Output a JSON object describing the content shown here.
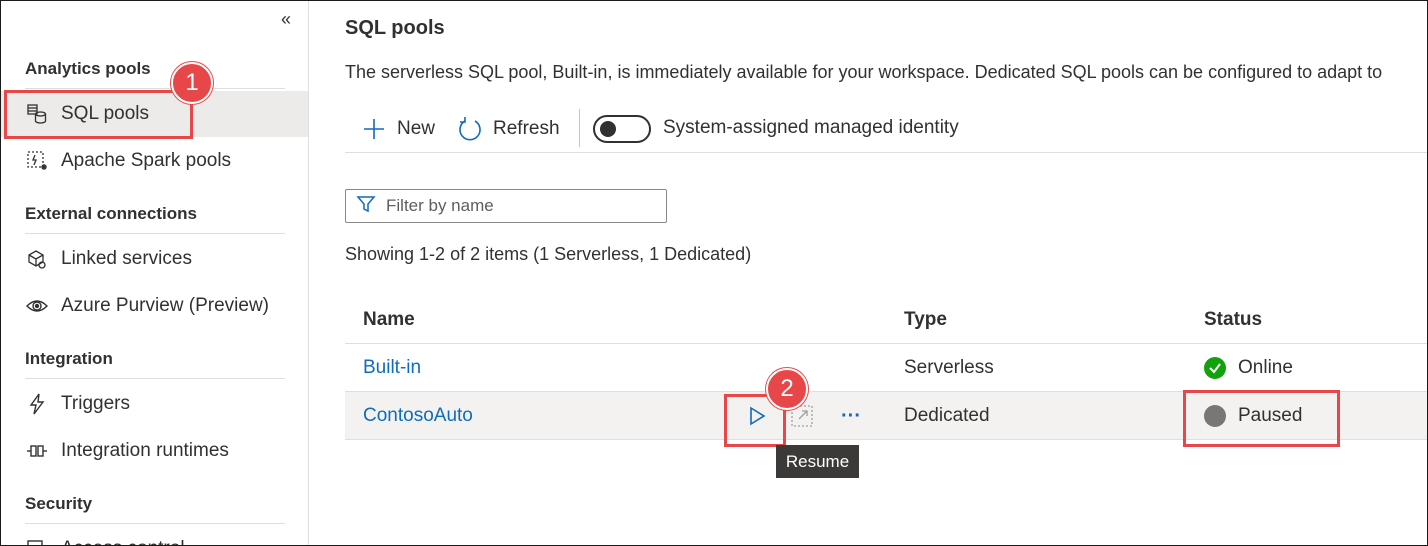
{
  "sidebar": {
    "collapse_glyph": "«",
    "sections": [
      {
        "heading": "Analytics pools"
      },
      {
        "heading": "External connections"
      },
      {
        "heading": "Integration"
      },
      {
        "heading": "Security"
      }
    ],
    "items": [
      {
        "label": "SQL pools",
        "icon": "sql-pool-icon",
        "selected": true
      },
      {
        "label": "Apache Spark pools",
        "icon": "spark-pool-icon"
      },
      {
        "label": "Linked services",
        "icon": "linked-services-icon"
      },
      {
        "label": "Azure Purview (Preview)",
        "icon": "purview-icon"
      },
      {
        "label": "Triggers",
        "icon": "lightning-icon"
      },
      {
        "label": "Integration runtimes",
        "icon": "integration-runtime-icon"
      },
      {
        "label": "Access control",
        "icon": "access-control-icon"
      }
    ]
  },
  "main": {
    "title": "SQL pools",
    "description": "The serverless SQL pool, Built-in, is immediately available for your workspace. Dedicated SQL pools can be configured to adapt to",
    "toolbar": {
      "new_label": "New",
      "refresh_label": "Refresh",
      "identity_toggle_label": "System-assigned managed identity",
      "identity_toggle_on": false
    },
    "filter": {
      "placeholder": "Filter by name",
      "value": ""
    },
    "showing": "Showing 1-2 of 2 items (1 Serverless, 1 Dedicated)",
    "table": {
      "columns": [
        "Name",
        "Type",
        "Status"
      ],
      "rows": [
        {
          "name": "Built-in",
          "type": "Serverless",
          "status": "Online"
        },
        {
          "name": "ContosoAuto",
          "type": "Dedicated",
          "status": "Paused"
        }
      ]
    },
    "row_actions": {
      "resume_tooltip": "Resume",
      "more_glyph": "···"
    }
  },
  "callouts": {
    "step1": "1",
    "step2": "2"
  },
  "colors": {
    "accent": "#0f6cbd",
    "callout": "#e8474a",
    "online": "#13a10e",
    "paused": "#797775",
    "selected_bg": "#edebe9"
  }
}
